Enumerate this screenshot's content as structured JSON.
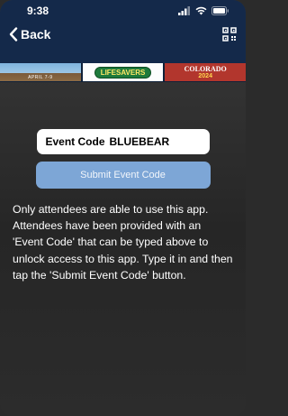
{
  "status_bar": {
    "time": "9:38",
    "icons": [
      "signal-icon",
      "wifi-icon",
      "battery-icon"
    ]
  },
  "nav": {
    "back_label": "Back",
    "right_icon": "qr-code-icon"
  },
  "banner": {
    "slot1_date": "APRIL 7-9",
    "slot2_title": "LIFESAVERS",
    "slot3_title": "COLORADO",
    "slot3_year": "2024"
  },
  "event_code": {
    "label": "Event Code",
    "value": "BLUEBEAR"
  },
  "submit": {
    "label": "Submit Event Code"
  },
  "info_text": "Only attendees are able to use this app. Attendees have been provided with an 'Event Code' that can be typed above to unlock access to this app. Type it in and then tap the 'Submit Event Code' button.",
  "colors": {
    "header_bg": "#14294a",
    "button_bg": "#7da6d6",
    "text": "#ffffff"
  }
}
